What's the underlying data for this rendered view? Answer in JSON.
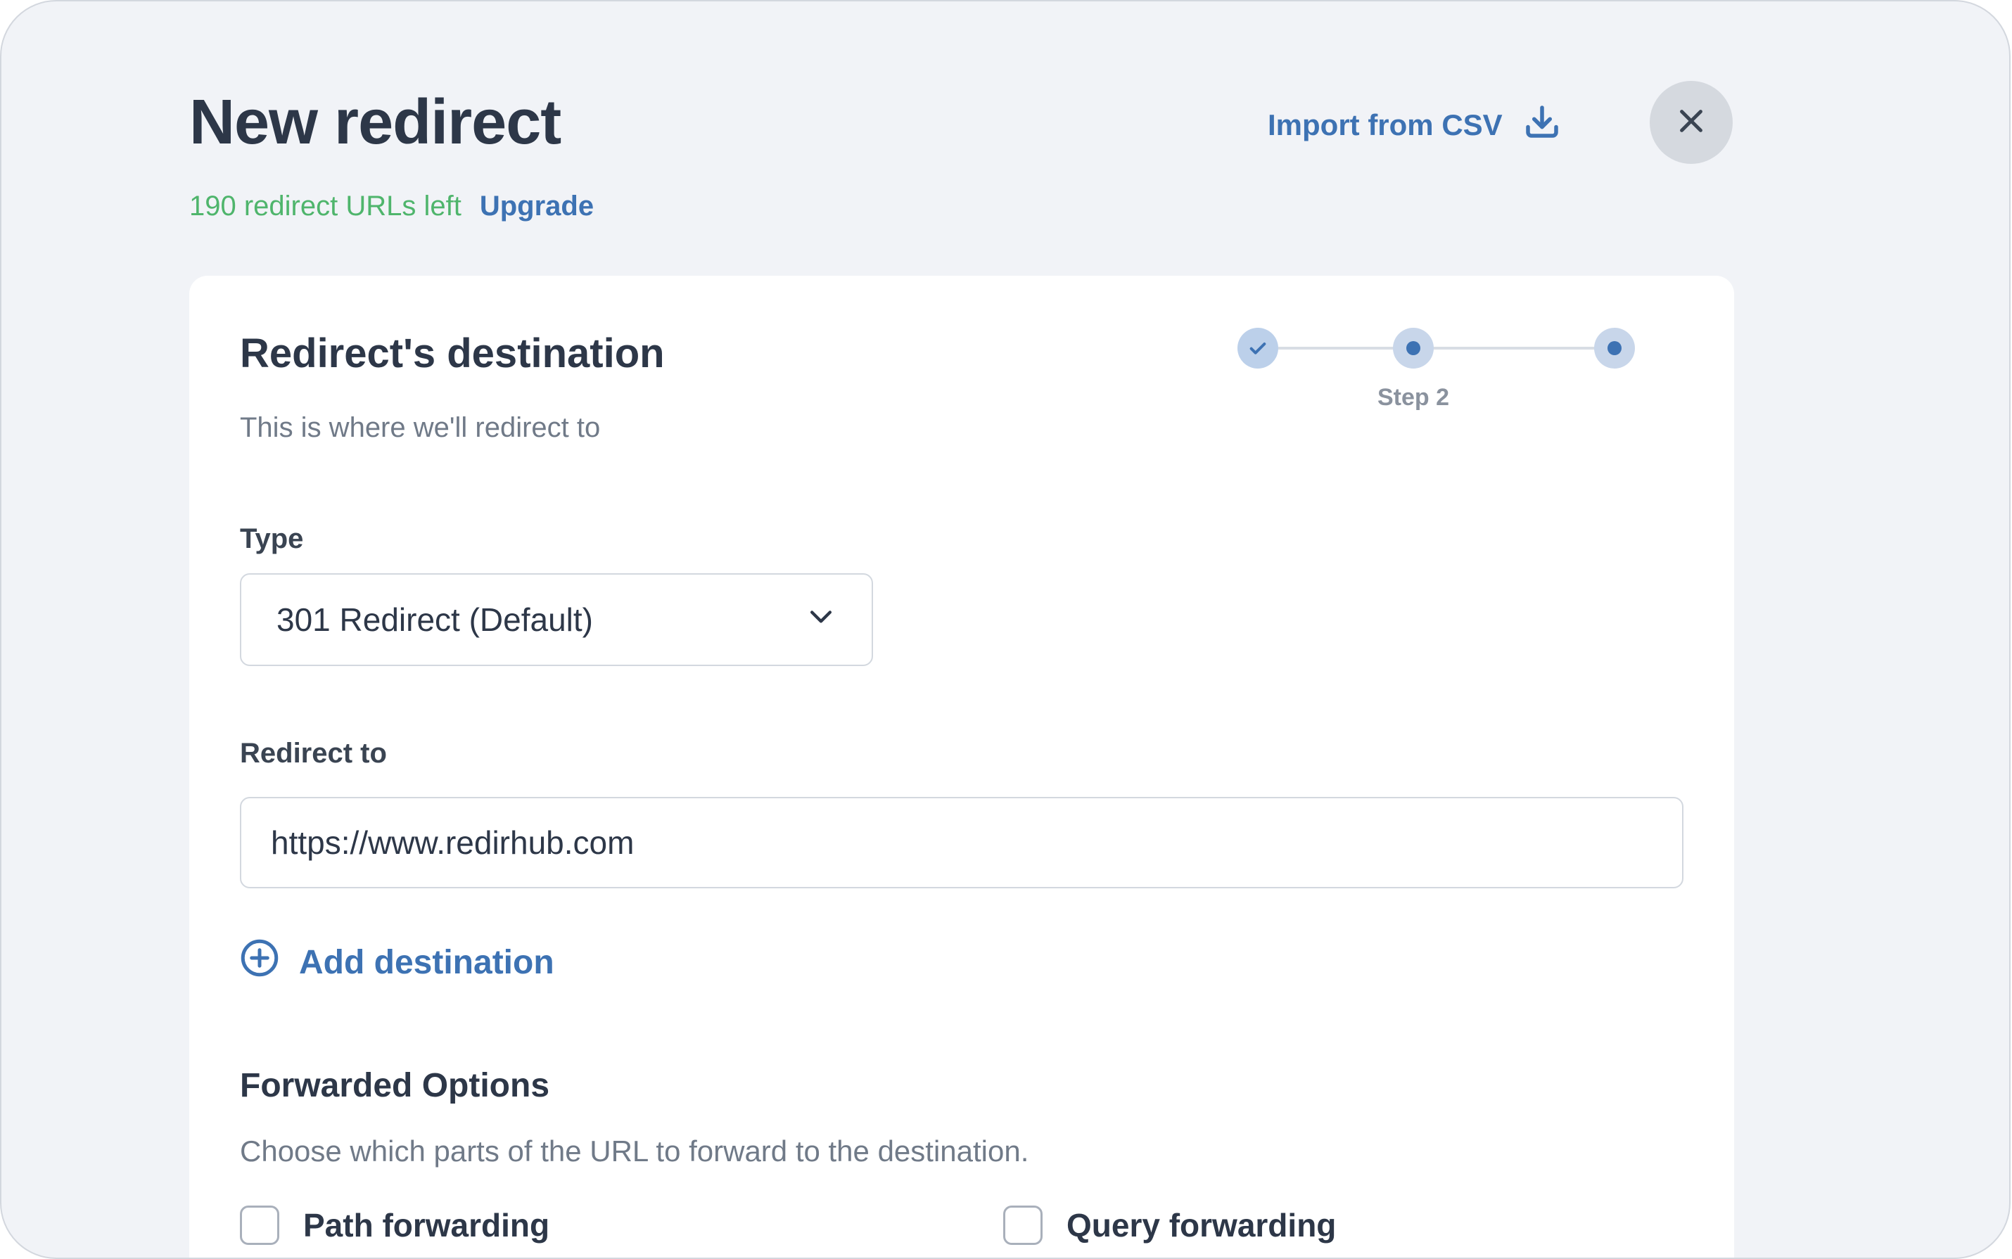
{
  "header": {
    "title": "New redirect",
    "quota_text": "190 redirect URLs left",
    "upgrade_label": "Upgrade",
    "import_label": "Import from CSV",
    "import_icon": "download-icon",
    "close_icon": "close-icon"
  },
  "card": {
    "title": "Redirect's destination",
    "subtitle": "This is where we'll redirect to",
    "stepper": {
      "steps": 3,
      "current_step": 2,
      "current_label": "Step 2"
    },
    "type_field": {
      "label": "Type",
      "value": "301 Redirect (Default)"
    },
    "redirect_field": {
      "label": "Redirect to",
      "value": "https://www.redirhub.com"
    },
    "add_destination_label": "Add destination",
    "forwarded": {
      "title": "Forwarded Options",
      "description": "Choose which parts of the URL to forward to the destination.",
      "options": [
        {
          "label": "Path forwarding",
          "checked": false
        },
        {
          "label": "Query forwarding",
          "checked": false
        }
      ]
    }
  },
  "colors": {
    "background": "#f1f3f7",
    "accent": "#3d72b3",
    "quota_green": "#4fb56c",
    "title_text": "#2d3748",
    "muted_text": "#707a88"
  }
}
